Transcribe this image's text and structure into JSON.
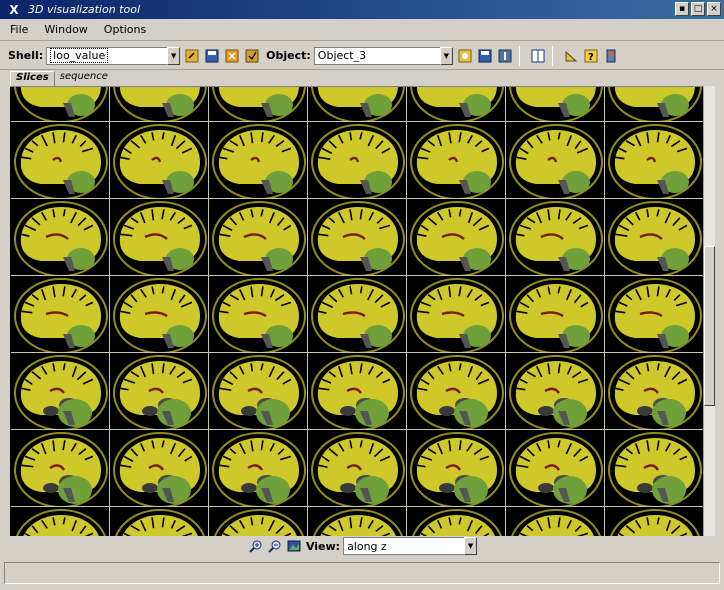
{
  "window": {
    "title": "3D visualization tool"
  },
  "menu": {
    "file": "File",
    "window": "Window",
    "options": "Options"
  },
  "toolbar": {
    "shell_label": "Shell:",
    "shell_value": "loo_value",
    "object_label": "Object:",
    "object_value": "Object_3"
  },
  "tabs": {
    "slices": "Slices",
    "sequence": "sequence"
  },
  "view": {
    "label": "View:",
    "value": "along z"
  },
  "colors": {
    "brain": "#cfc82a",
    "cerebellum": "#6fa03a",
    "ventricle": "#7a1a10",
    "gridline": "#c9c9a9",
    "titlebar": "#0a246a"
  }
}
